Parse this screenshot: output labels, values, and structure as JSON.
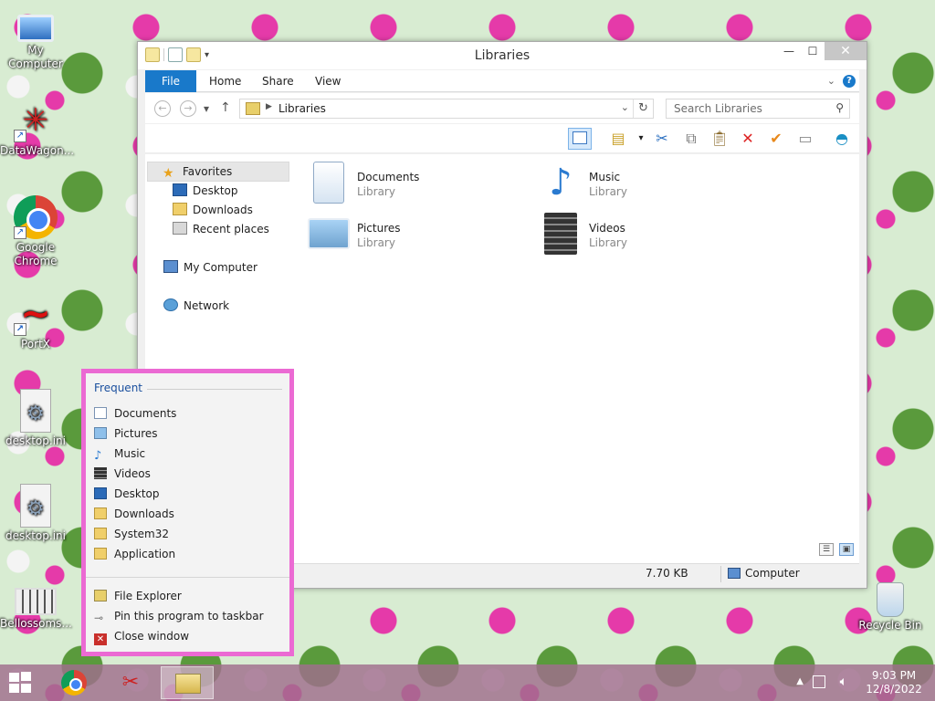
{
  "desktop": {
    "icons": [
      {
        "label": "My Computer"
      },
      {
        "label": "DataWagon..."
      },
      {
        "label": "Google Chrome"
      },
      {
        "label": "PortX"
      },
      {
        "label": "desktop.ini"
      },
      {
        "label": "desktop.ini"
      },
      {
        "label": "Bellossoms..."
      },
      {
        "label": "Recycle Bin"
      }
    ]
  },
  "window": {
    "title": "Libraries",
    "tabs": {
      "file": "File",
      "home": "Home",
      "share": "Share",
      "view": "View"
    },
    "address": {
      "path": "Libraries"
    },
    "search": {
      "placeholder": "Search Libraries"
    },
    "nav": {
      "favorites": "Favorites",
      "desktop": "Desktop",
      "downloads": "Downloads",
      "recent": "Recent places",
      "computer": "My Computer",
      "network": "Network"
    },
    "libraries": [
      {
        "name": "Documents",
        "type": "Library"
      },
      {
        "name": "Music",
        "type": "Library"
      },
      {
        "name": "Pictures",
        "type": "Library"
      },
      {
        "name": "Videos",
        "type": "Library"
      }
    ],
    "status": {
      "size": "7.70 KB",
      "zone": "Computer"
    }
  },
  "jumplist": {
    "header": "Frequent",
    "frequent": [
      "Documents",
      "Pictures",
      "Music",
      "Videos",
      "Desktop",
      "Downloads",
      "System32",
      "Application"
    ],
    "tasks": [
      "File Explorer",
      "Pin this program to taskbar",
      "Close window"
    ],
    "border_color": "#eb6ad3"
  },
  "taskbar": {
    "time": "9:03 PM",
    "date": "12/8/2022"
  },
  "colors": {
    "accent": "#1979ca"
  }
}
